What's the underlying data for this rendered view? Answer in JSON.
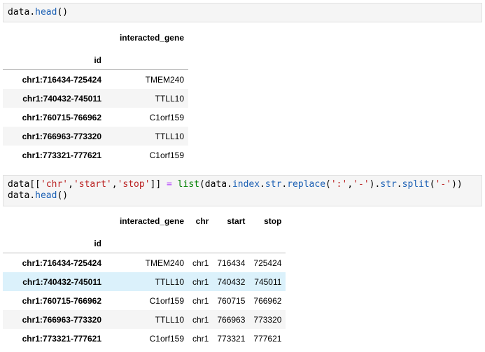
{
  "cell1": {
    "code": {
      "obj": "data",
      "dot": ".",
      "method": "head",
      "parens": "()"
    },
    "output": {
      "columns": [
        "interacted_gene"
      ],
      "index_name": "id",
      "rows": [
        {
          "id": "chr1:716434-725424",
          "interacted_gene": "TMEM240"
        },
        {
          "id": "chr1:740432-745011",
          "interacted_gene": "TTLL10"
        },
        {
          "id": "chr1:760715-766962",
          "interacted_gene": "C1orf159"
        },
        {
          "id": "chr1:766963-773320",
          "interacted_gene": "TTLL10"
        },
        {
          "id": "chr1:773321-777621",
          "interacted_gene": "C1orf159"
        }
      ]
    }
  },
  "cell2": {
    "code": {
      "p1": "data[[",
      "s1": "'chr'",
      "c1": ",",
      "s2": "'start'",
      "c2": ",",
      "s3": "'stop'",
      "p2": "]] ",
      "eq": "=",
      "sp": " ",
      "fn": "list",
      "p3": "(data.",
      "a1": "index",
      "d1": ".",
      "a2": "str",
      "d2": ".",
      "a3": "replace",
      "p4": "(",
      "s4": "':'",
      "c3": ",",
      "s5": "'-'",
      "p5": ").",
      "a4": "str",
      "d3": ".",
      "a5": "split",
      "p6": "(",
      "s6": "'-'",
      "p7": "))",
      "line2_obj": "data",
      "line2_dot": ".",
      "line2_method": "head",
      "line2_parens": "()"
    },
    "output": {
      "columns": [
        "interacted_gene",
        "chr",
        "start",
        "stop"
      ],
      "index_name": "id",
      "rows": [
        {
          "id": "chr1:716434-725424",
          "interacted_gene": "TMEM240",
          "chr": "chr1",
          "start": "716434",
          "stop": "725424"
        },
        {
          "id": "chr1:740432-745011",
          "interacted_gene": "TTLL10",
          "chr": "chr1",
          "start": "740432",
          "stop": "745011"
        },
        {
          "id": "chr1:760715-766962",
          "interacted_gene": "C1orf159",
          "chr": "chr1",
          "start": "760715",
          "stop": "766962"
        },
        {
          "id": "chr1:766963-773320",
          "interacted_gene": "TTLL10",
          "chr": "chr1",
          "start": "766963",
          "stop": "773320"
        },
        {
          "id": "chr1:773321-777621",
          "interacted_gene": "C1orf159",
          "chr": "chr1",
          "start": "773321",
          "stop": "777621"
        }
      ]
    }
  }
}
